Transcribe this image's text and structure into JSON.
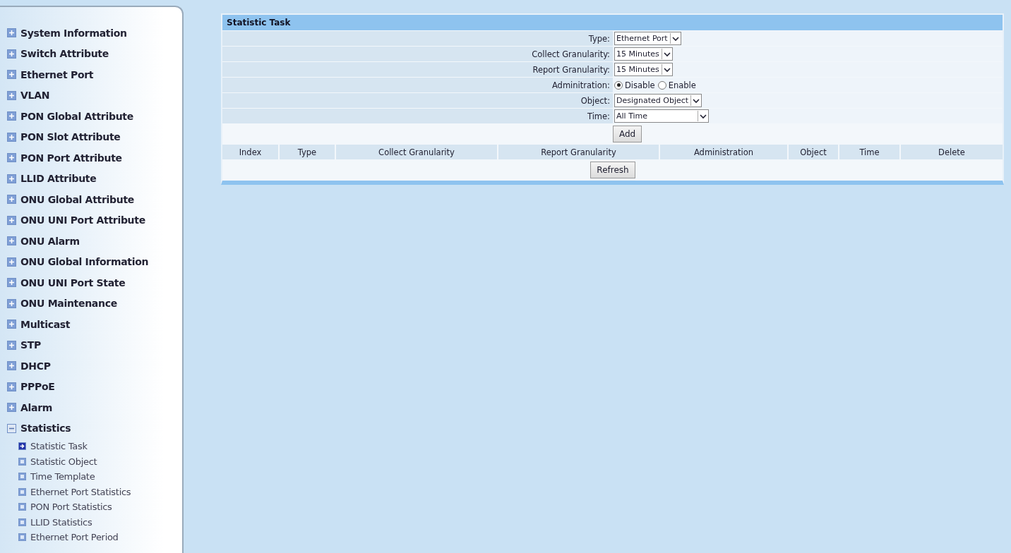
{
  "sidebar": {
    "items": [
      {
        "label": "System Information",
        "expanded": false
      },
      {
        "label": "Switch Attribute",
        "expanded": false
      },
      {
        "label": "Ethernet Port",
        "expanded": false
      },
      {
        "label": "VLAN",
        "expanded": false
      },
      {
        "label": "PON Global Attribute",
        "expanded": false
      },
      {
        "label": "PON Slot Attribute",
        "expanded": false
      },
      {
        "label": "PON Port Attribute",
        "expanded": false
      },
      {
        "label": "LLID Attribute",
        "expanded": false
      },
      {
        "label": "ONU Global Attribute",
        "expanded": false
      },
      {
        "label": "ONU UNI Port Attribute",
        "expanded": false
      },
      {
        "label": "ONU Alarm",
        "expanded": false
      },
      {
        "label": "ONU Global Information",
        "expanded": false
      },
      {
        "label": "ONU UNI Port State",
        "expanded": false
      },
      {
        "label": "ONU Maintenance",
        "expanded": false
      },
      {
        "label": "Multicast",
        "expanded": false
      },
      {
        "label": "STP",
        "expanded": false
      },
      {
        "label": "DHCP",
        "expanded": false
      },
      {
        "label": "PPPoE",
        "expanded": false
      },
      {
        "label": "Alarm",
        "expanded": false
      },
      {
        "label": "Statistics",
        "expanded": true,
        "children": [
          {
            "label": "Statistic Task",
            "selected": true
          },
          {
            "label": "Statistic Object",
            "selected": false
          },
          {
            "label": "Time Template",
            "selected": false
          },
          {
            "label": "Ethernet Port Statistics",
            "selected": false
          },
          {
            "label": "PON Port Statistics",
            "selected": false
          },
          {
            "label": "LLID Statistics",
            "selected": false
          },
          {
            "label": "Ethernet Port Period",
            "selected": false
          }
        ]
      }
    ]
  },
  "panel": {
    "title": "Statistic Task",
    "fields": [
      {
        "kind": "select",
        "label": "Type:",
        "value": "Ethernet Port"
      },
      {
        "kind": "select",
        "label": "Collect Granularity:",
        "value": "15 Minutes"
      },
      {
        "kind": "select",
        "label": "Report Granularity:",
        "value": "15 Minutes"
      },
      {
        "kind": "radio",
        "label": "Adminitration:",
        "options": [
          {
            "label": "Disable",
            "selected": true
          },
          {
            "label": "Enable",
            "selected": false
          }
        ]
      },
      {
        "kind": "select",
        "label": "Object:",
        "value": "Designated Object"
      },
      {
        "kind": "select",
        "label": "Time:",
        "value": "All Time",
        "wide": true
      }
    ],
    "add_button": "Add",
    "table": {
      "columns": [
        "Index",
        "Type",
        "Collect Granularity",
        "Report Granularity",
        "Administration",
        "Object",
        "Time",
        "Delete"
      ]
    },
    "refresh_button": "Refresh"
  }
}
